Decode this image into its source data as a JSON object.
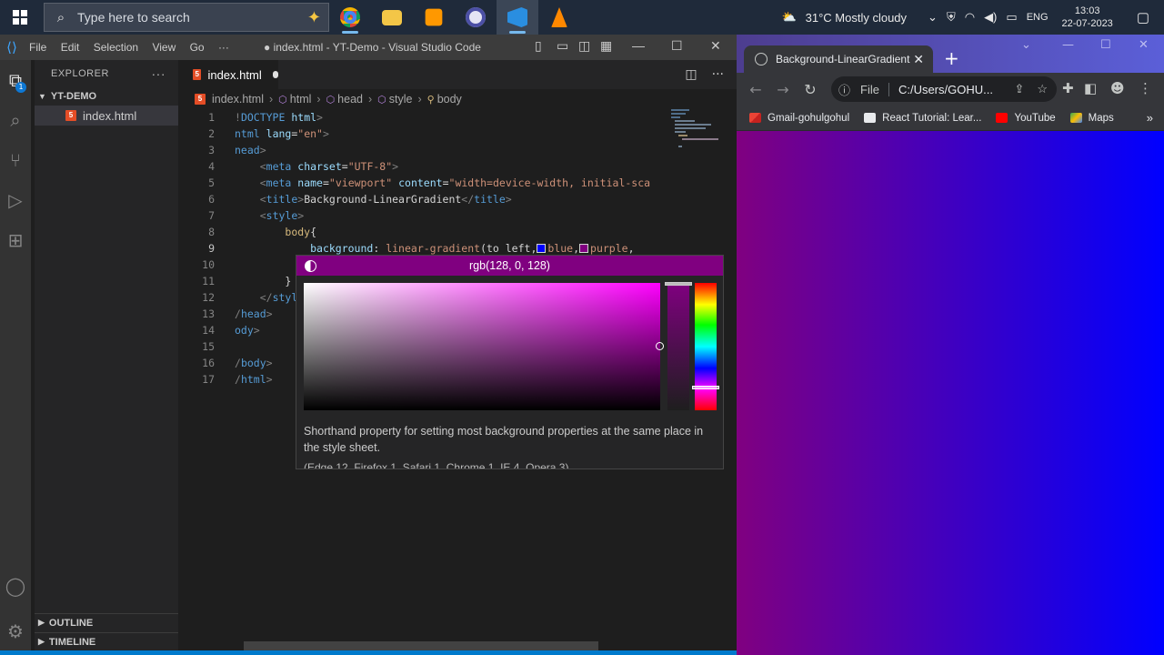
{
  "taskbar": {
    "search_placeholder": "Type here to search",
    "weather": "31°C  Mostly cloudy",
    "language": "ENG",
    "time": "13:03",
    "date": "22-07-2023"
  },
  "vscode": {
    "window_title": "● index.html - YT-Demo - Visual Studio Code",
    "menu": [
      "File",
      "Edit",
      "Selection",
      "View",
      "Go",
      "···"
    ],
    "activity_badge": "1",
    "explorer": {
      "header": "EXPLORER",
      "folder": "YT-DEMO",
      "file": "index.html",
      "outline": "OUTLINE",
      "timeline": "TIMELINE"
    },
    "tab": {
      "label": "index.html"
    },
    "breadcrumbs": [
      "index.html",
      "html",
      "head",
      "style",
      "body"
    ],
    "line_numbers": [
      "1",
      "2",
      "3",
      "4",
      "5",
      "6",
      "7",
      "8",
      "9",
      "10",
      "11",
      "12",
      "13",
      "14",
      "15",
      "16",
      "17"
    ],
    "color_picker": {
      "value": "rgb(128, 0, 128)",
      "description": "Shorthand property for setting most background properties at the same place in the style sheet.",
      "compat": "(Edge 12, Firefox 1, Safari 1, Chrome 1, IE 4, Opera 3)"
    }
  },
  "chrome": {
    "tab_title": "Background-LinearGradient",
    "address_label": "File",
    "address": "C:/Users/GOHU...",
    "bookmarks": [
      "Gmail-gohulgohul",
      "React Tutorial: Lear...",
      "YouTube",
      "Maps"
    ]
  },
  "colors": {
    "gradient_from": "#800080",
    "gradient_to": "#0000ff",
    "vscode_accent": "#007acc"
  }
}
